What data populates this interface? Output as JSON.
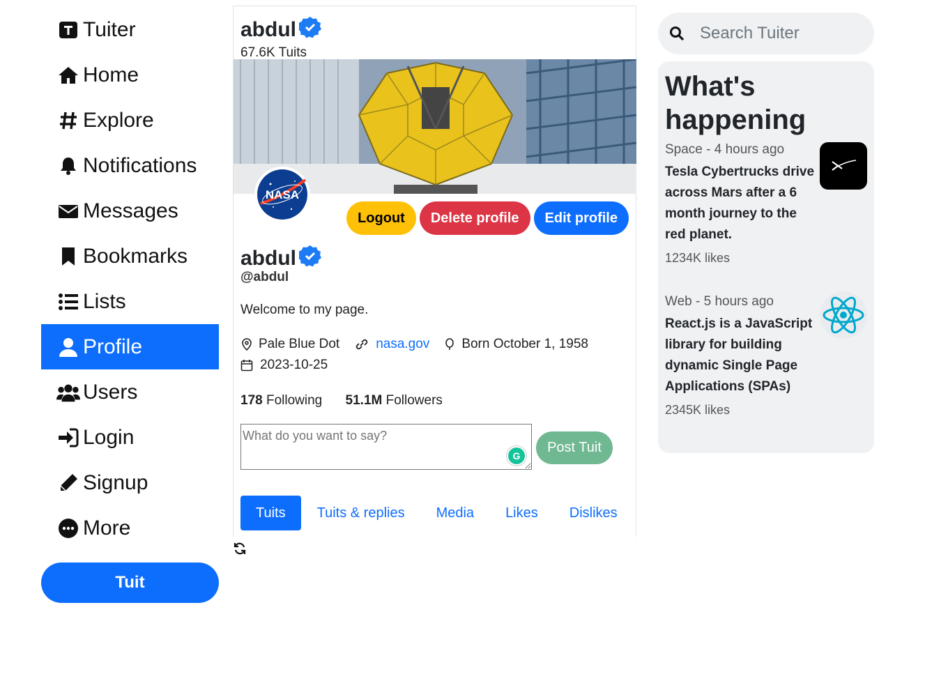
{
  "nav": {
    "brand": "Tuiter",
    "items": [
      {
        "label": "Home",
        "icon": "home-icon"
      },
      {
        "label": "Explore",
        "icon": "hashtag-icon"
      },
      {
        "label": "Notifications",
        "icon": "bell-icon"
      },
      {
        "label": "Messages",
        "icon": "envelope-icon"
      },
      {
        "label": "Bookmarks",
        "icon": "bookmark-icon"
      },
      {
        "label": "Lists",
        "icon": "list-icon"
      },
      {
        "label": "Profile",
        "icon": "user-icon",
        "active": true
      },
      {
        "label": "Users",
        "icon": "users-icon"
      },
      {
        "label": "Login",
        "icon": "sign-in-icon"
      },
      {
        "label": "Signup",
        "icon": "pencil-icon"
      },
      {
        "label": "More",
        "icon": "more-icon"
      }
    ],
    "tuit_button": "Tuit"
  },
  "profile": {
    "name": "abdul",
    "tuit_count": "67.6K Tuits",
    "avatar_text": "NASA",
    "buttons": {
      "logout": "Logout",
      "delete": "Delete profile",
      "edit": "Edit profile"
    },
    "handle": "@abdul",
    "bio": "Welcome to my page.",
    "location": "Pale Blue Dot",
    "website": "nasa.gov",
    "born": "Born October 1, 1958",
    "joined": "2023-10-25",
    "following_count": "178",
    "following_label": "Following",
    "followers_count": "51.1M",
    "followers_label": "Followers",
    "compose_placeholder": "What do you want to say?",
    "grammarly_letter": "G",
    "post_button": "Post Tuit",
    "tabs": [
      "Tuits",
      "Tuits & replies",
      "Media",
      "Likes",
      "Dislikes"
    ],
    "active_tab": "Tuits"
  },
  "search": {
    "placeholder": "Search Tuiter"
  },
  "happening": {
    "title": "What's happening",
    "trends": [
      {
        "topic": "Space",
        "time": "4 hours ago",
        "headline": "Tesla Cybertrucks drive across Mars after a 6 month journey to the red planet.",
        "likes": "1234K likes",
        "thumb": "spacex-icon"
      },
      {
        "topic": "Web",
        "time": "5 hours ago",
        "headline": "React.js is a JavaScript library for building dynamic Single Page Applications (SPAs)",
        "likes": "2345K likes",
        "thumb": "react-icon"
      }
    ]
  },
  "colors": {
    "primary": "#0d6efd",
    "warning": "#ffc107",
    "danger": "#dc3545",
    "success_muted": "#6fb892",
    "panel": "#eff1f3"
  }
}
